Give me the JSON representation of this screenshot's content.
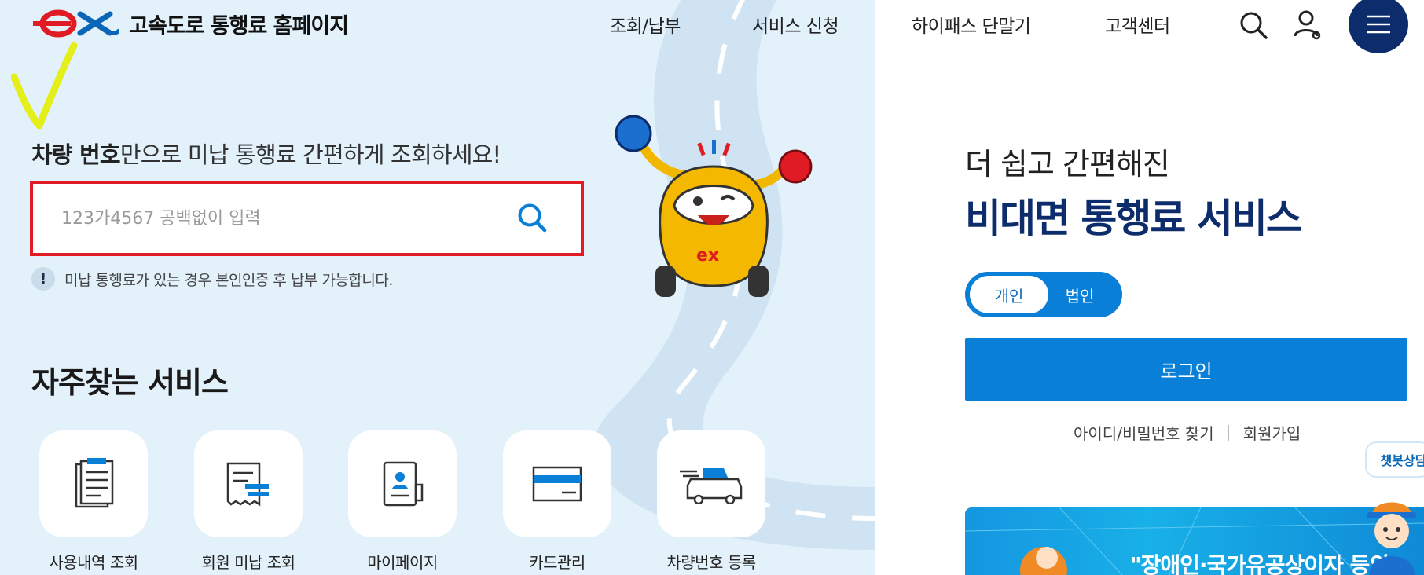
{
  "header": {
    "site_title": "고속도로 통행료 홈페이지",
    "nav": [
      "조회/납부",
      "서비스 신청",
      "하이패스 단말기",
      "고객센터"
    ]
  },
  "search": {
    "headline_bold": "차량 번호",
    "headline_rest": "만으로 미납 통행료 간편하게 조회하세요!",
    "placeholder": "123가4567 공백없이 입력",
    "value": "",
    "notice": "미납 통행료가 있는 경우 본인인증 후 납부 가능합니다.",
    "notice_icon": "!"
  },
  "services": {
    "title": "자주찾는 서비스",
    "items": [
      {
        "label": "사용내역 조회",
        "icon": "clipboard-icon"
      },
      {
        "label": "회원 미납 조회",
        "icon": "receipt-icon"
      },
      {
        "label": "마이페이지",
        "icon": "profile-book-icon"
      },
      {
        "label": "카드관리",
        "icon": "card-icon"
      },
      {
        "label": "차량번호 등록",
        "icon": "car-icon"
      }
    ]
  },
  "login_panel": {
    "subtitle": "더 쉽고 간편해진",
    "title": "비대면 통행료 서비스",
    "toggle": {
      "active": "개인",
      "inactive": "법인"
    },
    "login_button": "로그인",
    "find_link": "아이디/비밀번호 찾기",
    "signup_link": "회원가입"
  },
  "chatbot": {
    "label": "챗봇상담"
  },
  "banner": {
    "text": "\"장애인·국가유공상이자 등의"
  },
  "colors": {
    "brand_navy": "#0d2c6b",
    "accent_blue": "#0a7fd8",
    "alert_red": "#e01b24",
    "bg_light_blue": "#e3f1fb"
  }
}
